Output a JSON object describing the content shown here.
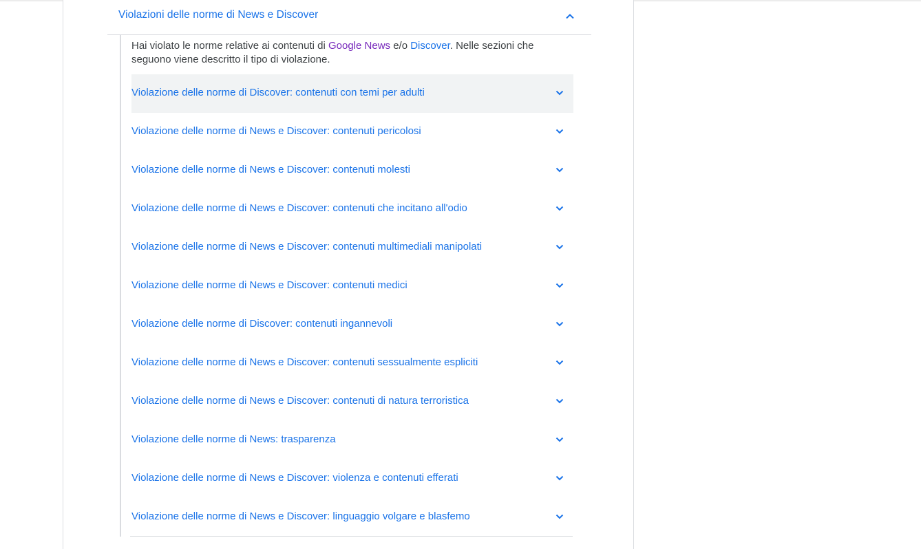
{
  "section": {
    "title": "Violazioni delle norme di News e Discover",
    "expanded_icon": "chevron-up-icon"
  },
  "intro": {
    "part1": "Hai violato le norme relative ai contenuti di ",
    "link_google_news": "Google News",
    "part2": " e/o ",
    "link_discover": "Discover",
    "part3": ". Nelle sezioni che seguono viene descritto il tipo di violazione."
  },
  "items": [
    {
      "label": "Violazione delle norme di Discover: contenuti con temi per adulti"
    },
    {
      "label": "Violazione delle norme di News e Discover: contenuti pericolosi"
    },
    {
      "label": "Violazione delle norme di News e Discover: contenuti molesti"
    },
    {
      "label": "Violazione delle norme di News e Discover: contenuti che incitano all'odio"
    },
    {
      "label": "Violazione delle norme di News e Discover: contenuti multimediali manipolati"
    },
    {
      "label": "Violazione delle norme di News e Discover: contenuti medici"
    },
    {
      "label": "Violazione delle norme di Discover: contenuti ingannevoli"
    },
    {
      "label": "Violazione delle norme di News e Discover: contenuti sessualmente espliciti"
    },
    {
      "label": "Violazione delle norme di News e Discover: contenuti di natura terroristica"
    },
    {
      "label": "Violazione delle norme di News: trasparenza"
    },
    {
      "label": "Violazione delle norme di News e Discover: violenza e contenuti efferati"
    },
    {
      "label": "Violazione delle norme di News e Discover: linguaggio volgare e blasfemo"
    }
  ],
  "item_icon": "chevron-down-icon",
  "colors": {
    "link": "#1a73e8",
    "visited_link": "#7627bb",
    "text": "#3c4043",
    "divider": "#dadce0",
    "hover_bg": "#f1f3f4"
  }
}
